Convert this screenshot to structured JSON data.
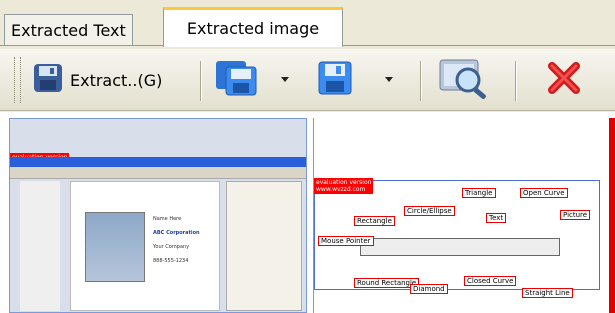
{
  "tabs": [
    {
      "label": "Extracted Text"
    },
    {
      "label": "Extracted image"
    }
  ],
  "toolbar": {
    "extract_label": "Extract..(G)"
  },
  "preview_left": {
    "eval_text": "evaluation version",
    "card_lines": [
      "Name Here",
      "ABC Corporation",
      "Your Company",
      "888-555-1234"
    ]
  },
  "preview_right": {
    "eval_text": "evaluation version\nwww.wvzzd.com",
    "callouts": [
      "Mouse Pointer",
      "Rectangle",
      "Circle/Ellipse",
      "Triangle",
      "Text",
      "Open Curve",
      "Picture",
      "Round Rectangle",
      "Diamond",
      "Closed Curve",
      "Straight Line"
    ]
  },
  "colors": {
    "accent": "#FFC83C",
    "highlight": "#E00000",
    "title_blue": "#2B5EDA"
  }
}
